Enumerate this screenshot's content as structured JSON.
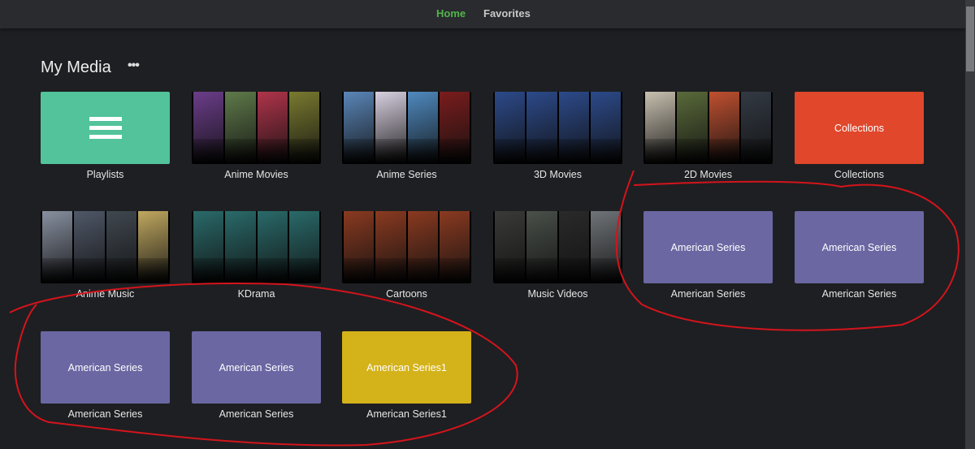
{
  "nav": {
    "home": "Home",
    "favorites": "Favorites",
    "active_color": "#52b54b"
  },
  "section": {
    "title": "My Media",
    "more_icon": "more-horizontal-icon"
  },
  "tiles": [
    {
      "label": "Playlists",
      "type": "icon",
      "color": "#52c39a"
    },
    {
      "label": "Anime Movies",
      "type": "posters",
      "colors": [
        "#6b3d8a",
        "#5f7a4a",
        "#b0344a",
        "#7a7a30"
      ]
    },
    {
      "label": "Anime Series",
      "type": "posters",
      "colors": [
        "#5a86b8",
        "#d8d0e0",
        "#4f8ac0",
        "#7a1c1c"
      ]
    },
    {
      "label": "3D Movies",
      "type": "posters",
      "colors": [
        "#2c4a8a",
        "#2c4a8a",
        "#2c4a8a",
        "#2c4a8a"
      ]
    },
    {
      "label": "2D Movies",
      "type": "posters",
      "colors": [
        "#c8c0b0",
        "#5a6a3a",
        "#c05030",
        "#333a44"
      ]
    },
    {
      "label": "Collections",
      "type": "solid",
      "text": "Collections",
      "color": "#e0472b"
    },
    {
      "label": "Anime Music",
      "type": "posters",
      "colors": [
        "#8890a0",
        "#505868",
        "#404850",
        "#c0a860"
      ]
    },
    {
      "label": "KDrama",
      "type": "posters",
      "colors": [
        "#2a6a6a",
        "#2a6a6a",
        "#2a6a6a",
        "#2a6a6a"
      ]
    },
    {
      "label": "Cartoons",
      "type": "posters",
      "colors": [
        "#8a3a20",
        "#8a3a20",
        "#8a3a20",
        "#8a3a20"
      ]
    },
    {
      "label": "Music Videos",
      "type": "posters",
      "colors": [
        "#3a3a38",
        "#4a504a",
        "#2a2a2a",
        "#707478"
      ]
    },
    {
      "label": "American Series",
      "type": "solid",
      "text": "American Series",
      "color": "#6a67a2"
    },
    {
      "label": "American Series",
      "type": "solid",
      "text": "American Series",
      "color": "#6a67a2"
    },
    {
      "label": "American Series",
      "type": "solid",
      "text": "American Series",
      "color": "#6a67a2"
    },
    {
      "label": "American Series",
      "type": "solid",
      "text": "American Series",
      "color": "#6a67a2"
    },
    {
      "label": "American Series1",
      "type": "solid",
      "text": "American Series1",
      "color": "#d4b21a"
    }
  ]
}
